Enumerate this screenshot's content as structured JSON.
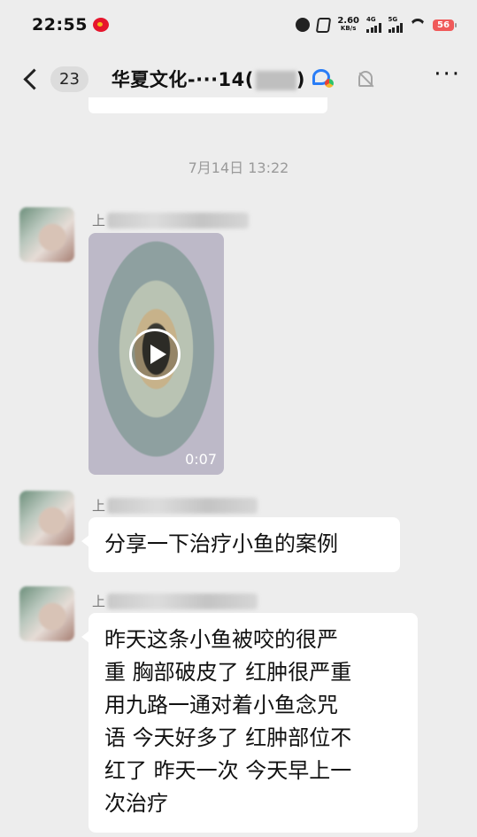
{
  "status_bar": {
    "time": "22:55",
    "net_speed": "2.60",
    "net_speed_unit": "KB/s",
    "net_1": "4G",
    "net_2": "5G",
    "battery": "56"
  },
  "header": {
    "back_badge": "23",
    "title": "华夏文化-···14(",
    "title_suffix": ")"
  },
  "chat": {
    "timestamp": "7月14日 13:22",
    "messages": [
      {
        "sender_prefix": "上",
        "type": "video",
        "duration": "0:07"
      },
      {
        "sender_prefix": "上",
        "type": "text",
        "text": "分享一下治疗小鱼的案例"
      },
      {
        "sender_prefix": "上",
        "type": "text",
        "lines": [
          "昨天这条小鱼被咬的很严",
          "重 胸部破皮了 红肿很严重",
          "用九路一通对着小鱼念咒",
          "语 今天好多了 红肿部位不",
          "红了 昨天一次 今天早上一",
          "次治疗"
        ]
      }
    ]
  },
  "icons": {
    "status_left": "weibo-icon",
    "status_right": [
      "alarm-icon",
      "mute-icon",
      "signal-icon",
      "wifi-icon",
      "battery-icon"
    ],
    "header": [
      "back-icon",
      "search-chat-icon",
      "bell-off-icon",
      "more-icon"
    ],
    "video": "play-icon"
  }
}
